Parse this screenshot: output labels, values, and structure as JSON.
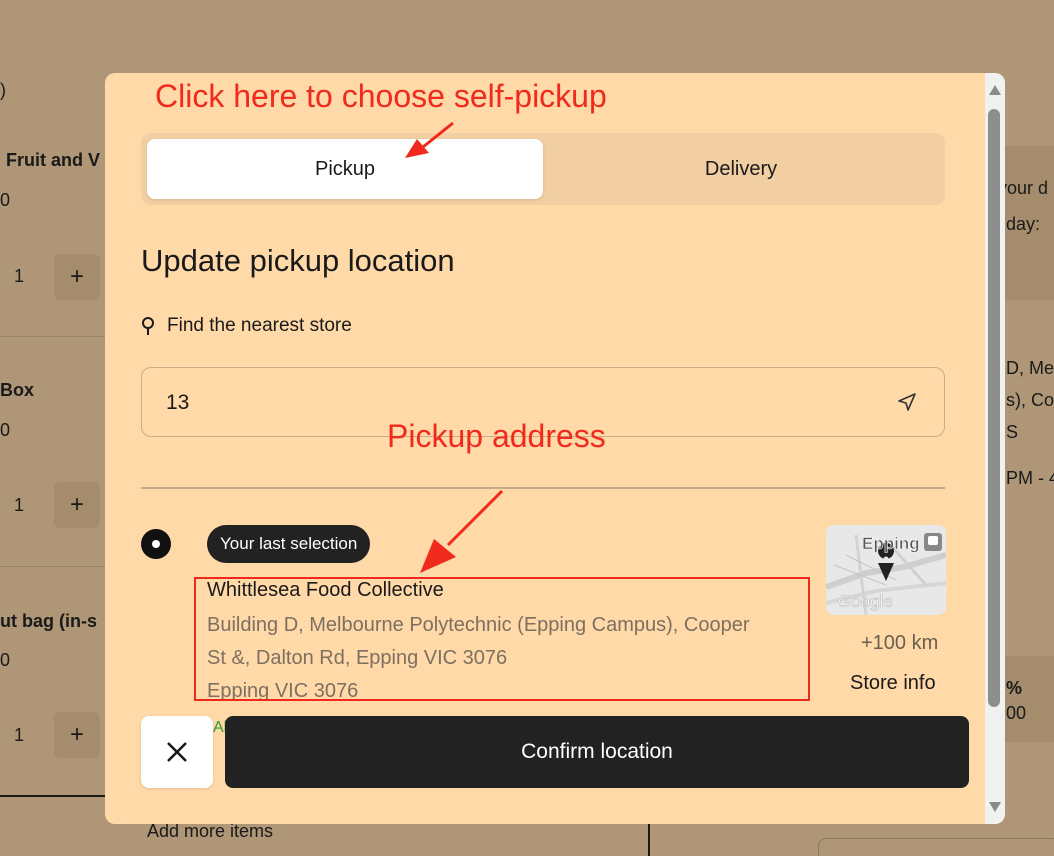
{
  "background": {
    "left_column": {
      "fragments": [
        ")",
        "Fruit and V",
        "0",
        "Box",
        "0",
        "ut bag (in-s",
        "0"
      ],
      "qty_value": "1",
      "plus_label": "+"
    },
    "right_column": {
      "fragments": [
        "your d",
        "day:",
        "D, Me",
        "s), Coo",
        "S",
        "PM - 4",
        "%",
        "00"
      ]
    },
    "footer_link": "Add more items"
  },
  "modal": {
    "annotations": {
      "pickup_hint": "Click here to choose self-pickup",
      "address_hint": "Pickup address"
    },
    "tabs": [
      {
        "label": "Pickup",
        "active": true
      },
      {
        "label": "Delivery",
        "active": false
      }
    ],
    "heading": "Update pickup location",
    "find_nearest": "Find the nearest store",
    "search": {
      "value": "13"
    },
    "store": {
      "badge": "Your last selection",
      "name": "Whittlesea Food Collective",
      "address_lines": [
        "Building D, Melbourne Polytechnic (Epping Campus), Cooper",
        "St &, Dalton Rd, Epping VIC 3076",
        "Epping VIC 3076"
      ],
      "map_label": "Epping",
      "map_brand": "Google",
      "distance": "+100 km",
      "store_info": "Store info",
      "partial_green_text": "Al"
    },
    "confirm_label": "Confirm location"
  },
  "colors": {
    "modal_bg": "#ffd9a8",
    "annotation_red": "#f02a1d",
    "dark_button": "#222222",
    "overlay": "#ae9676"
  }
}
